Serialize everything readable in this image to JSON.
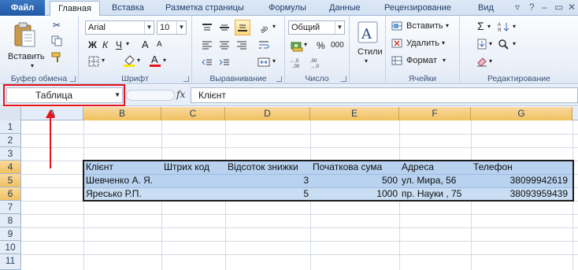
{
  "tabs": {
    "file": "Файл",
    "items": [
      "Главная",
      "Вставка",
      "Разметка страницы",
      "Формулы",
      "Данные",
      "Рецензирование",
      "Вид"
    ]
  },
  "ribbon": {
    "clipboard": {
      "label": "Буфер обмена",
      "paste": "Вставить"
    },
    "font": {
      "label": "Шрифт",
      "name": "Arial",
      "size": "10",
      "bold": "Ж",
      "italic": "К",
      "underline": "Ч",
      "grow": "A",
      "shrink": "A"
    },
    "alignment": {
      "label": "Выравнивание"
    },
    "number": {
      "label": "Число",
      "format": "Общий",
      "percent": "%",
      "thousands": "000"
    },
    "styles": {
      "label": "Стили"
    },
    "cells": {
      "label": "Ячейки",
      "insert": "Вставить",
      "delete": "Удалить",
      "format": "Формат"
    },
    "editing": {
      "label": "Редактирование"
    }
  },
  "formula_bar": {
    "name_box": "Таблица",
    "fx": "fx",
    "content": "Клієнт"
  },
  "sheet": {
    "columns": [
      "A",
      "B",
      "C",
      "D",
      "E",
      "F",
      "G"
    ],
    "rows": [
      "1",
      "2",
      "3",
      "4",
      "5",
      "6",
      "7",
      "8",
      "9",
      "10",
      "11"
    ],
    "table": {
      "headers": [
        "Клієнт",
        "Штрих код",
        "Відсоток знижки",
        "Початкова сума",
        "Адреса",
        "Телефон"
      ],
      "data": [
        [
          "Шевченко А. Я.",
          "",
          "3",
          "500",
          "ул. Мира, 56",
          "38099942619"
        ],
        [
          "Яресько Р.П.",
          "",
          "5",
          "1000",
          "пр. Науки , 75",
          "38093959439"
        ]
      ]
    }
  },
  "colors": {
    "accent": "#1f5aa6",
    "table_band": "#b8d2ef",
    "annotation": "#e8141c",
    "selection": "#f1c15f"
  }
}
